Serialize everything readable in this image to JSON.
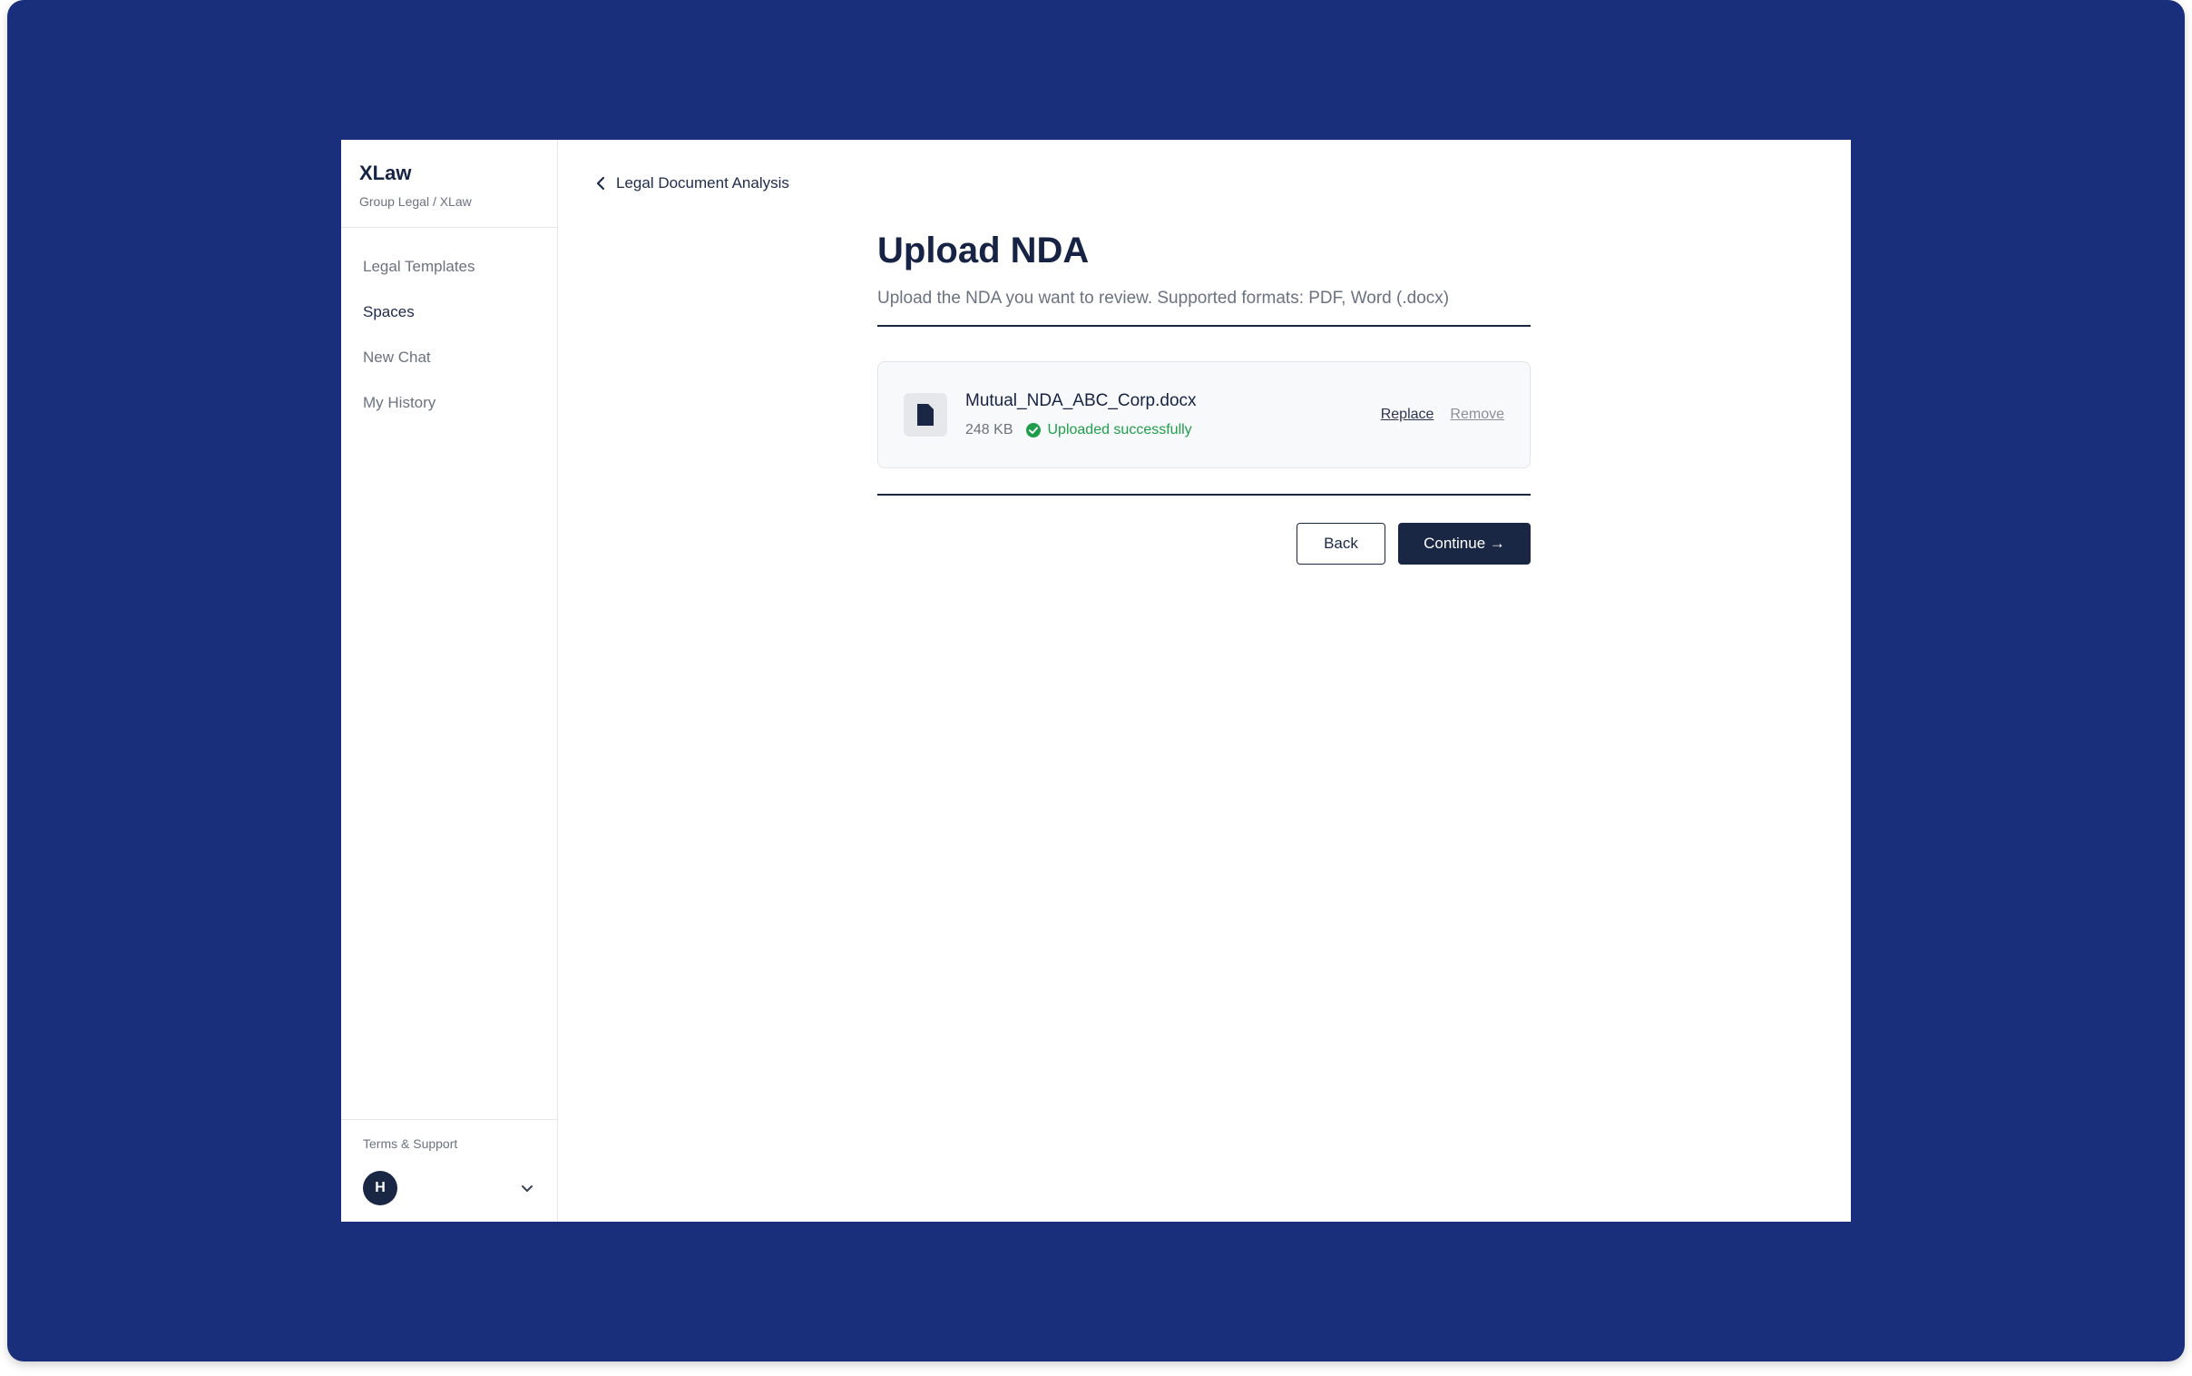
{
  "app": {
    "name": "XLaw",
    "org_path": "Group Legal / XLaw"
  },
  "sidebar": {
    "items": [
      {
        "label": "Legal Templates",
        "active": false
      },
      {
        "label": "Spaces",
        "active": true
      },
      {
        "label": "New Chat",
        "active": false
      },
      {
        "label": "My History",
        "active": false
      }
    ],
    "footer_link": "Terms & Support",
    "user_initial": "H"
  },
  "breadcrumb": {
    "back_label": "Legal Document Analysis"
  },
  "page": {
    "title": "Upload NDA",
    "description": "Upload the NDA you want to review. Supported formats: PDF, Word (.docx)"
  },
  "file": {
    "name": "Mutual_NDA_ABC_Corp.docx",
    "size": "248 KB",
    "status": "Uploaded successfully",
    "replace_label": "Replace",
    "remove_label": "Remove"
  },
  "buttons": {
    "back": "Back",
    "continue": "Continue →"
  },
  "colors": {
    "backdrop": "#192f7b",
    "primary": "#1a2744",
    "success": "#1e9e4a"
  }
}
